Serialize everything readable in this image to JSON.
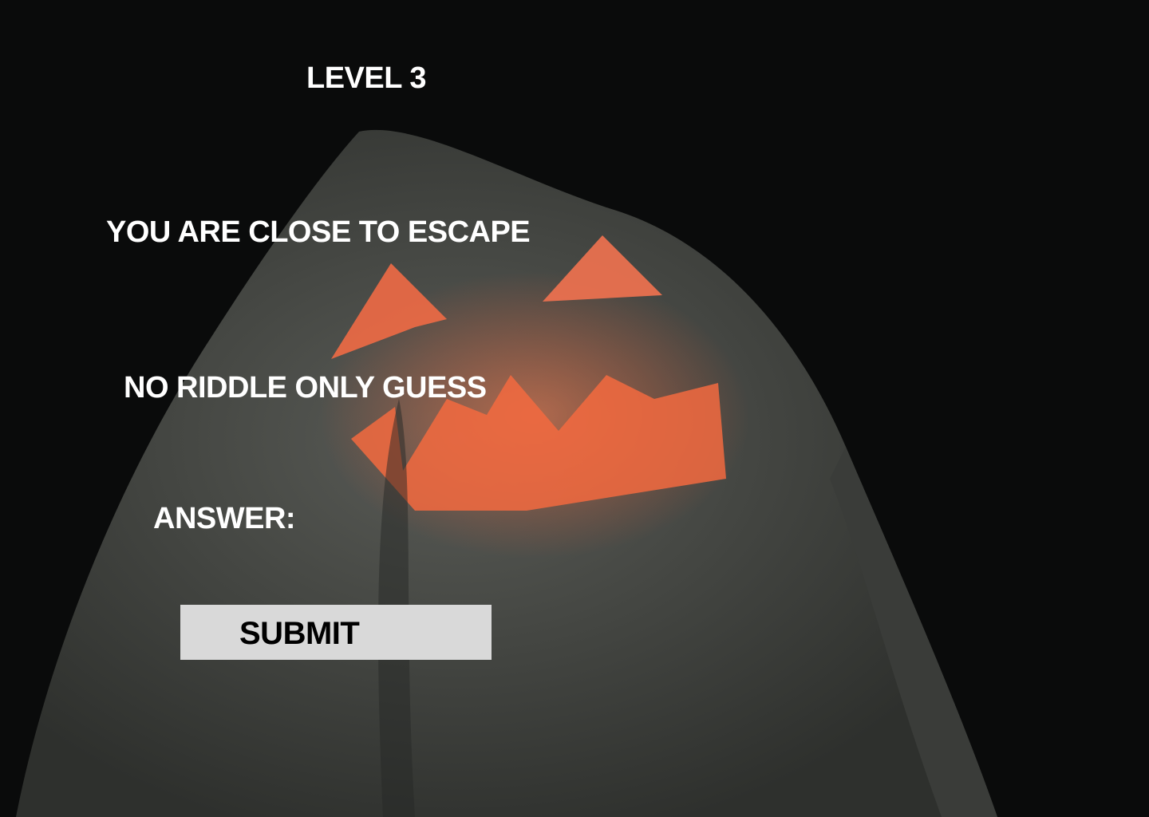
{
  "level_title": "LEVEL 3",
  "message": "YOU ARE CLOSE TO ESCAPE",
  "hint": "NO RIDDLE ONLY GUESS",
  "answer_label": "ANSWER:",
  "submit_label": "SUBMIT",
  "colors": {
    "background": "#0a0b0b",
    "ghost": "#4a4d49",
    "glow": "#ff6a3d",
    "button": "#d9d9d9"
  }
}
